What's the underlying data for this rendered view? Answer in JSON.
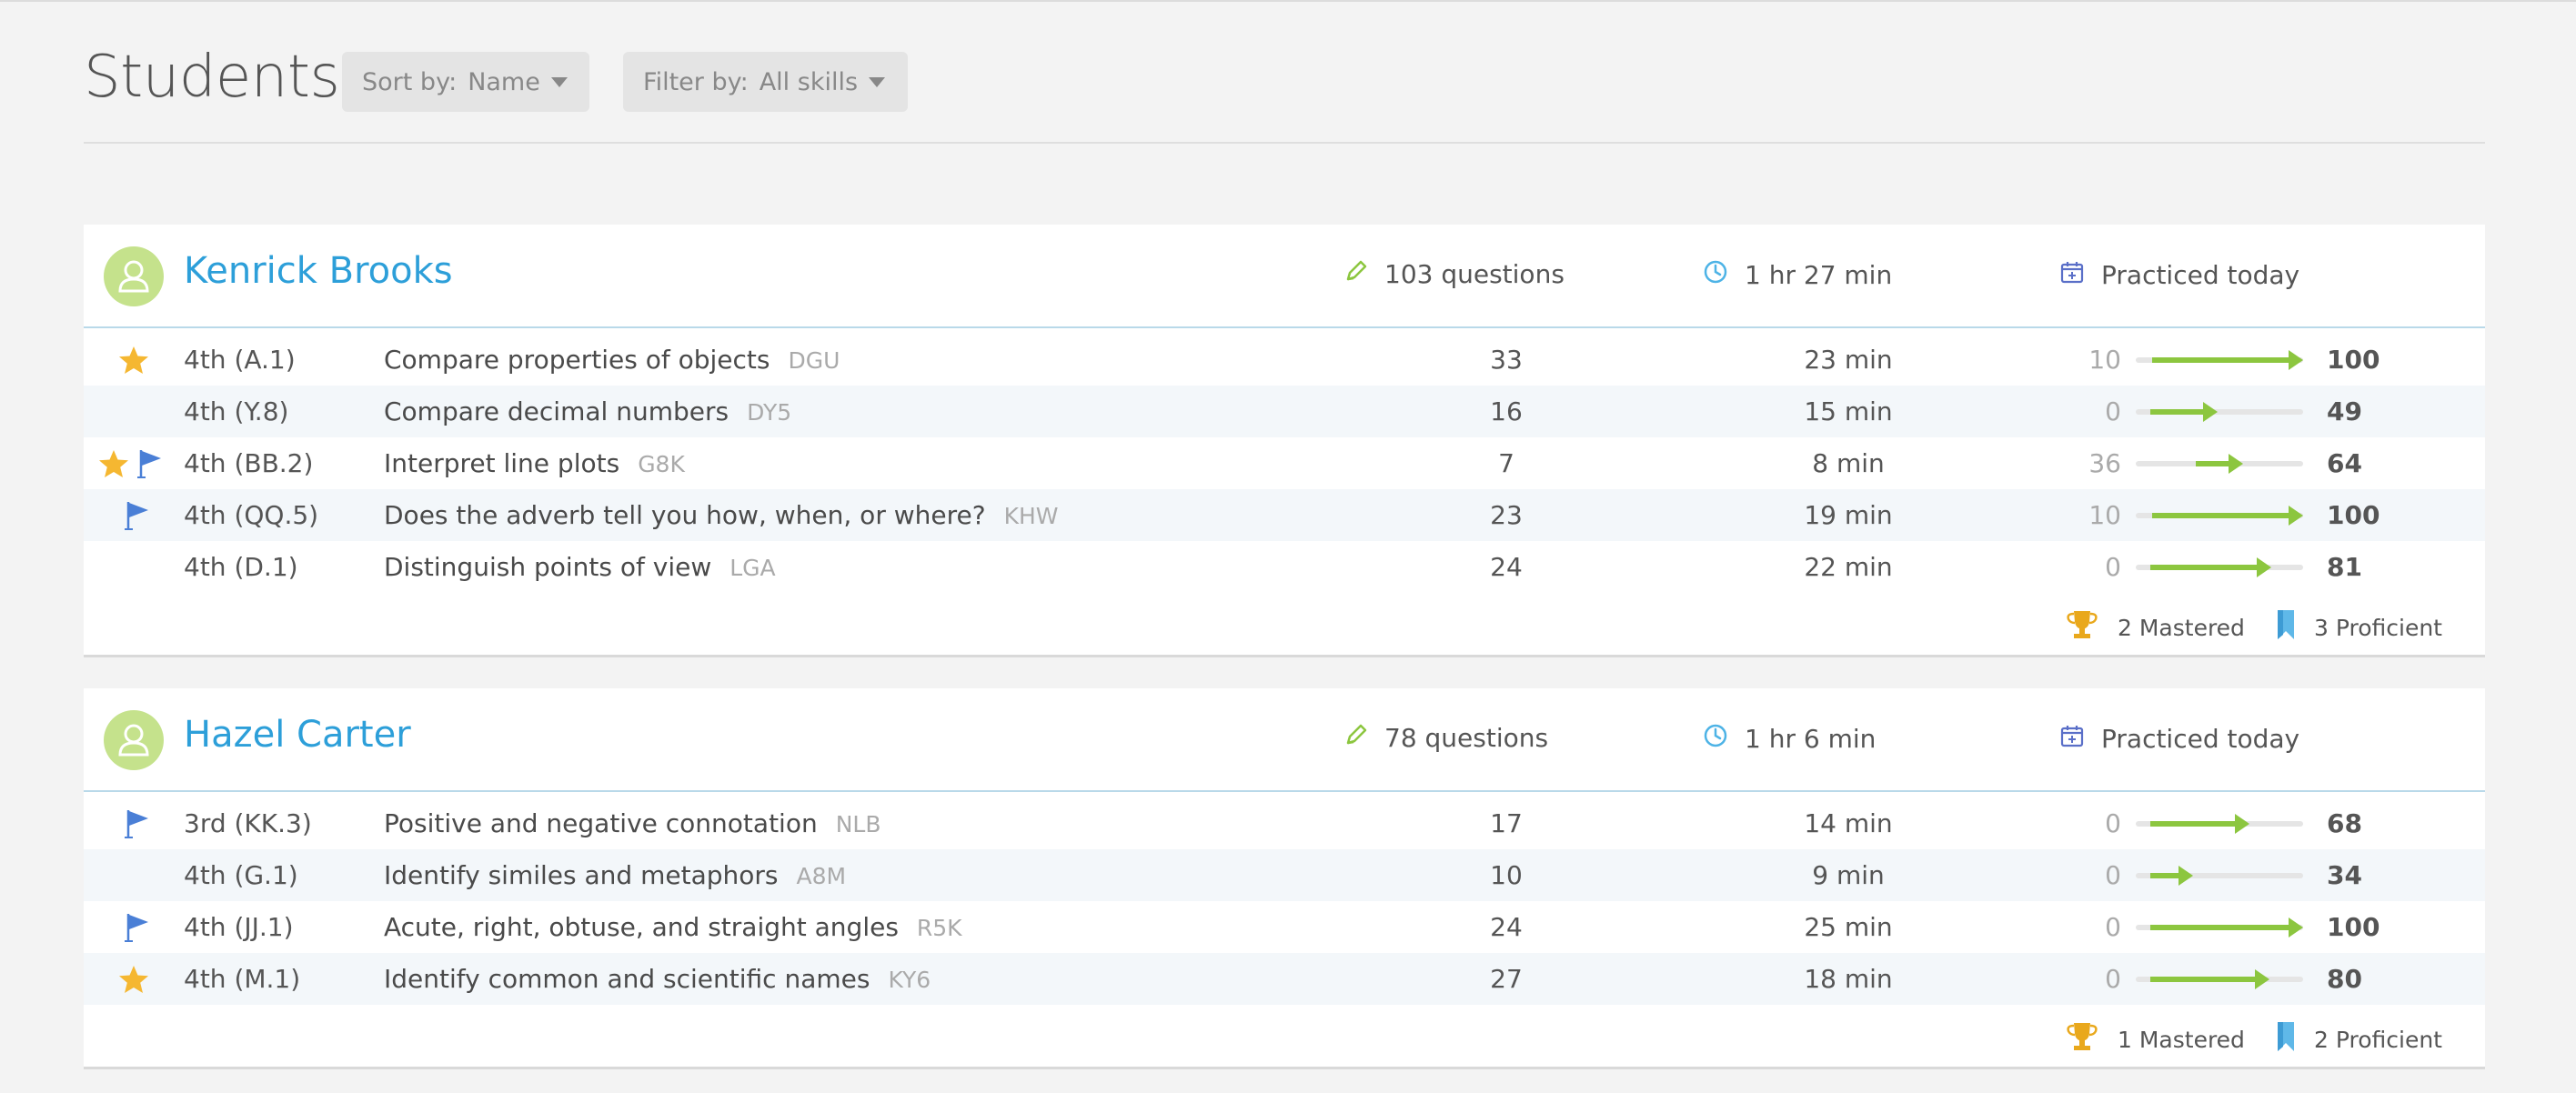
{
  "page": {
    "title": "Students",
    "sort": {
      "label": "Sort by:",
      "value": "Name"
    },
    "filter": {
      "label": "Filter by:",
      "value": "All skills"
    }
  },
  "students": [
    {
      "name": "Kenrick Brooks",
      "questions": "103 questions",
      "time": "1 hr 27 min",
      "practiced": "Practiced today",
      "skills": [
        {
          "star": true,
          "flag": false,
          "grade": "4th (A.1)",
          "skill": "Compare properties of objects",
          "code": "DGU",
          "questions": "33",
          "time": "23 min",
          "start": "10",
          "end": "100",
          "start_score": 10,
          "end_score": 100
        },
        {
          "star": false,
          "flag": false,
          "grade": "4th (Y.8)",
          "skill": "Compare decimal numbers",
          "code": "DY5",
          "questions": "16",
          "time": "15 min",
          "start": "0",
          "end": "49",
          "start_score": 0,
          "end_score": 49
        },
        {
          "star": true,
          "flag": true,
          "grade": "4th (BB.2)",
          "skill": "Interpret line plots",
          "code": "G8K",
          "questions": "7",
          "time": "8 min",
          "start": "36",
          "end": "64",
          "start_score": 36,
          "end_score": 64
        },
        {
          "star": false,
          "flag": true,
          "grade": "4th (QQ.5)",
          "skill": "Does the adverb tell you how, when, or where?",
          "code": "KHW",
          "questions": "23",
          "time": "19 min",
          "start": "10",
          "end": "100",
          "start_score": 10,
          "end_score": 100
        },
        {
          "star": false,
          "flag": false,
          "grade": "4th (D.1)",
          "skill": "Distinguish points of view",
          "code": "LGA",
          "questions": "24",
          "time": "22 min",
          "start": "0",
          "end": "81",
          "start_score": 0,
          "end_score": 81
        }
      ],
      "mastered": "2 Mastered",
      "proficient": "3 Proficient"
    },
    {
      "name": "Hazel Carter",
      "questions": "78 questions",
      "time": "1 hr 6 min",
      "practiced": "Practiced today",
      "skills": [
        {
          "star": false,
          "flag": true,
          "grade": "3rd (KK.3)",
          "skill": "Positive and negative connotation",
          "code": "NLB",
          "questions": "17",
          "time": "14 min",
          "start": "0",
          "end": "68",
          "start_score": 0,
          "end_score": 68
        },
        {
          "star": false,
          "flag": false,
          "grade": "4th (G.1)",
          "skill": "Identify similes and metaphors",
          "code": "A8M",
          "questions": "10",
          "time": "9 min",
          "start": "0",
          "end": "34",
          "start_score": 0,
          "end_score": 34
        },
        {
          "star": false,
          "flag": true,
          "grade": "4th (JJ.1)",
          "skill": "Acute, right, obtuse, and straight angles",
          "code": "R5K",
          "questions": "24",
          "time": "25 min",
          "start": "0",
          "end": "100",
          "start_score": 0,
          "end_score": 100
        },
        {
          "star": true,
          "flag": false,
          "grade": "4th (M.1)",
          "skill": "Identify common and scientific names",
          "code": "KY6",
          "questions": "27",
          "time": "18 min",
          "start": "0",
          "end": "80",
          "start_score": 0,
          "end_score": 80
        }
      ],
      "mastered": "1 Mastered",
      "proficient": "2 Proficient"
    }
  ],
  "colors": {
    "accent": "#2d9fd9",
    "progress": "#8cc63f",
    "star": "#f5b731",
    "flag": "#4a7fd6",
    "avatar": "#c5e28c"
  },
  "icons": {
    "questions": "pencil-icon",
    "time": "clock-icon",
    "practiced": "calendar-icon",
    "mastered": "trophy-icon",
    "proficient": "bookmark-icon",
    "star": "star-icon",
    "flag": "flag-icon",
    "avatar": "user-avatar-icon"
  }
}
